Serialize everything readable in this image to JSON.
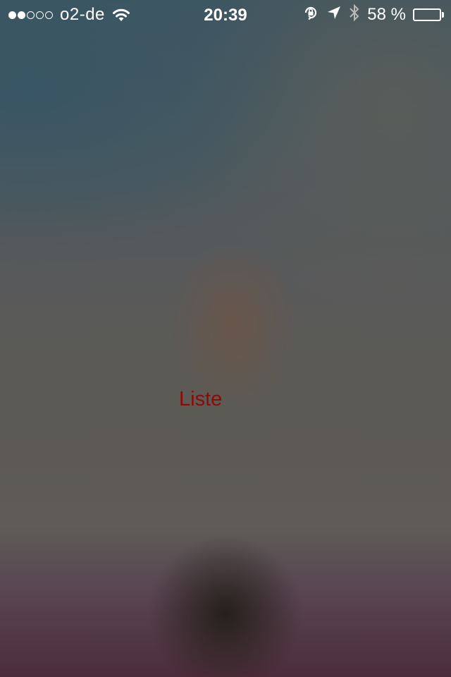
{
  "status_bar": {
    "signal": {
      "filled": 2,
      "total": 5
    },
    "carrier": "o2-de",
    "time": "20:39",
    "battery_percent_text": "58 %",
    "battery_level": 0.58,
    "icons": [
      "wifi-icon",
      "rotation-lock-icon",
      "location-arrow-icon",
      "bluetooth-icon",
      "battery-icon"
    ]
  },
  "main": {
    "label": "Liste",
    "label_color": "#8b0a0a"
  }
}
